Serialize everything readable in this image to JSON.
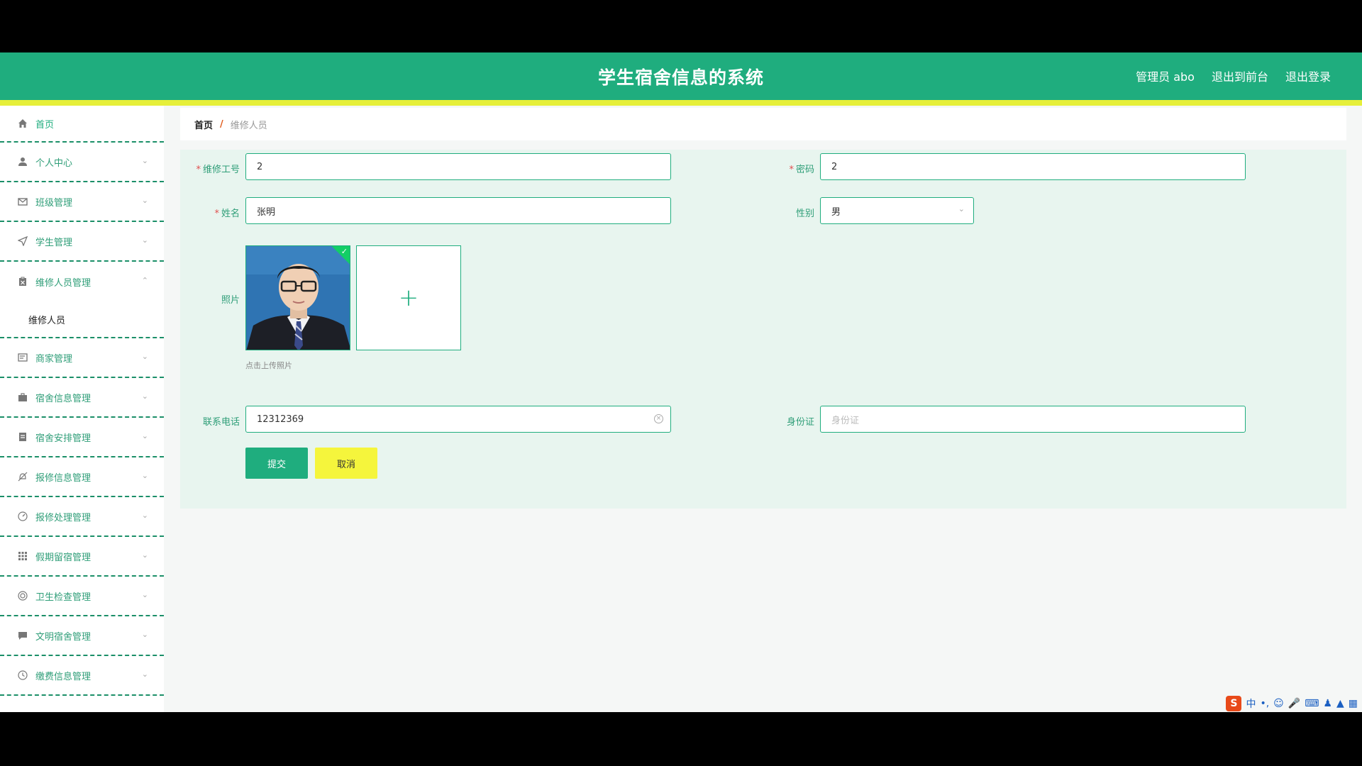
{
  "header": {
    "title": "学生宿舍信息的系统",
    "user": "管理员 abo",
    "to_front": "退出到前台",
    "logout": "退出登录"
  },
  "sidebar": {
    "items": [
      {
        "label": "首页",
        "icon": "home-icon"
      },
      {
        "label": "个人中心",
        "icon": "user-icon"
      },
      {
        "label": "班级管理",
        "icon": "mail-icon"
      },
      {
        "label": "学生管理",
        "icon": "send-icon"
      },
      {
        "label": "维修人员管理",
        "icon": "clipboard-icon"
      },
      {
        "label": "商家管理",
        "icon": "card-icon"
      },
      {
        "label": "宿舍信息管理",
        "icon": "briefcase-icon"
      },
      {
        "label": "宿舍安排管理",
        "icon": "document-icon"
      },
      {
        "label": "报修信息管理",
        "icon": "bell-off-icon"
      },
      {
        "label": "报修处理管理",
        "icon": "gauge-icon"
      },
      {
        "label": "假期留宿管理",
        "icon": "grid-icon"
      },
      {
        "label": "卫生检查管理",
        "icon": "target-icon"
      },
      {
        "label": "文明宿舍管理",
        "icon": "chat-icon"
      },
      {
        "label": "缴费信息管理",
        "icon": "clock-icon"
      }
    ],
    "submenu_label": "维修人员"
  },
  "breadcrumb": {
    "home": "首页",
    "separator": "/",
    "current": "维修人员"
  },
  "form": {
    "staff_no_label": "维修工号",
    "staff_no_value": "2",
    "password_label": "密码",
    "password_value": "2",
    "name_label": "姓名",
    "name_value": "张明",
    "gender_label": "性别",
    "gender_value": "男",
    "photo_label": "照片",
    "upload_tip": "点击上传照片",
    "phone_label": "联系电话",
    "phone_value": "12312369",
    "idcard_label": "身份证",
    "idcard_placeholder": "身份证",
    "submit": "提交",
    "cancel": "取消"
  },
  "tray": {
    "ime_logo": "S",
    "ime_lang": "中"
  },
  "colors": {
    "primary": "#1fad7e",
    "accent_stripe": "#e6ef3a",
    "cancel_button": "#f5f53c",
    "panel_bg": "#e8f5ef"
  }
}
